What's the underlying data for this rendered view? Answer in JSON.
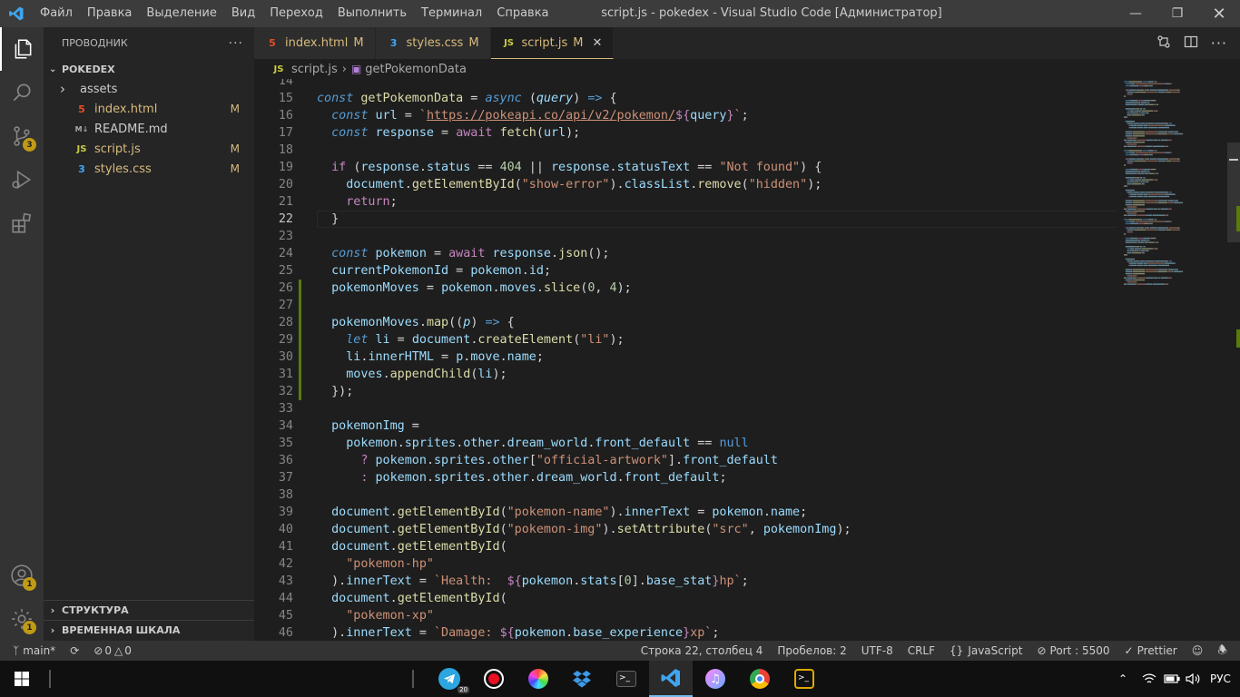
{
  "titlebar": {
    "menu": [
      "Файл",
      "Правка",
      "Выделение",
      "Вид",
      "Переход",
      "Выполнить",
      "Терминал",
      "Справка"
    ],
    "title": "script.js - pokedex - Visual Studio Code [Администратор]"
  },
  "activity": {
    "source_control_badge": "3",
    "accounts_badge": "1",
    "settings_badge": "1"
  },
  "explorer": {
    "header": "ПРОВОДНИК",
    "root": "POKEDEX",
    "items": [
      {
        "name": "assets",
        "icon": "folder-chevron",
        "mod": ""
      },
      {
        "name": "index.html",
        "icon": "html",
        "mod": "M"
      },
      {
        "name": "README.md",
        "icon": "md",
        "mod": ""
      },
      {
        "name": "script.js",
        "icon": "js",
        "mod": "M"
      },
      {
        "name": "styles.css",
        "icon": "css",
        "mod": "M"
      }
    ],
    "outline": "СТРУКТУРА",
    "timeline": "ВРЕМЕННАЯ ШКАЛА"
  },
  "tabs": [
    {
      "label": "index.html",
      "mod": "M",
      "icon": "html"
    },
    {
      "label": "styles.css",
      "mod": "M",
      "icon": "css"
    },
    {
      "label": "script.js",
      "mod": "M",
      "icon": "js",
      "active": true
    }
  ],
  "breadcrumb": {
    "file": "script.js",
    "symbol": "getPokemonData"
  },
  "editor": {
    "first_line": 14,
    "current_line": 22,
    "modified_lines": [
      26,
      27,
      28,
      29,
      30,
      31,
      32
    ]
  },
  "code_lines": [
    [],
    [
      [
        "kw",
        "const "
      ],
      [
        "fn",
        "getPokemonData"
      ],
      [
        "op",
        " = "
      ],
      [
        "kw",
        "async "
      ],
      [
        "op",
        "("
      ],
      [
        "prm",
        "query"
      ],
      [
        "op",
        ") "
      ],
      [
        "kw",
        "=>"
      ],
      [
        "op",
        " {"
      ]
    ],
    [
      [
        "op",
        "  "
      ],
      [
        "kw",
        "const "
      ],
      [
        "var",
        "url"
      ],
      [
        "op",
        " = "
      ],
      [
        "str",
        "`"
      ],
      [
        "url",
        "https://pokeapi.co/api/v2/pokemon/"
      ],
      [
        "kw2",
        "${"
      ],
      [
        "var",
        "query"
      ],
      [
        "kw2",
        "}"
      ],
      [
        "str",
        "`"
      ],
      [
        "op",
        ";"
      ]
    ],
    [
      [
        "op",
        "  "
      ],
      [
        "kw",
        "const "
      ],
      [
        "var",
        "response"
      ],
      [
        "op",
        " = "
      ],
      [
        "kw2",
        "await "
      ],
      [
        "fn",
        "fetch"
      ],
      [
        "op",
        "("
      ],
      [
        "var",
        "url"
      ],
      [
        "op",
        ");"
      ]
    ],
    [],
    [
      [
        "op",
        "  "
      ],
      [
        "kw2",
        "if "
      ],
      [
        "op",
        "("
      ],
      [
        "var",
        "response"
      ],
      [
        "op",
        "."
      ],
      [
        "var",
        "status"
      ],
      [
        "op",
        " == "
      ],
      [
        "num",
        "404"
      ],
      [
        "op",
        " || "
      ],
      [
        "var",
        "response"
      ],
      [
        "op",
        "."
      ],
      [
        "var",
        "statusText"
      ],
      [
        "op",
        " == "
      ],
      [
        "str",
        "\"Not found\""
      ],
      [
        "op",
        ") {"
      ]
    ],
    [
      [
        "op",
        "    "
      ],
      [
        "var",
        "document"
      ],
      [
        "op",
        "."
      ],
      [
        "fn",
        "getElementById"
      ],
      [
        "op",
        "("
      ],
      [
        "str",
        "\"show-error\""
      ],
      [
        "op",
        ")."
      ],
      [
        "var",
        "classList"
      ],
      [
        "op",
        "."
      ],
      [
        "fn",
        "remove"
      ],
      [
        "op",
        "("
      ],
      [
        "str",
        "\"hidden\""
      ],
      [
        "op",
        ");"
      ]
    ],
    [
      [
        "op",
        "    "
      ],
      [
        "kw2",
        "return"
      ],
      [
        "op",
        ";"
      ]
    ],
    [
      [
        "op",
        "  }"
      ]
    ],
    [],
    [
      [
        "op",
        "  "
      ],
      [
        "kw",
        "const "
      ],
      [
        "var",
        "pokemon"
      ],
      [
        "op",
        " = "
      ],
      [
        "kw2",
        "await "
      ],
      [
        "var",
        "response"
      ],
      [
        "op",
        "."
      ],
      [
        "fn",
        "json"
      ],
      [
        "op",
        "();"
      ]
    ],
    [
      [
        "op",
        "  "
      ],
      [
        "var",
        "currentPokemonId"
      ],
      [
        "op",
        " = "
      ],
      [
        "var",
        "pokemon"
      ],
      [
        "op",
        "."
      ],
      [
        "var",
        "id"
      ],
      [
        "op",
        ";"
      ]
    ],
    [
      [
        "op",
        "  "
      ],
      [
        "var",
        "pokemonMoves"
      ],
      [
        "op",
        " = "
      ],
      [
        "var",
        "pokemon"
      ],
      [
        "op",
        "."
      ],
      [
        "var",
        "moves"
      ],
      [
        "op",
        "."
      ],
      [
        "fn",
        "slice"
      ],
      [
        "op",
        "("
      ],
      [
        "num",
        "0"
      ],
      [
        "op",
        ", "
      ],
      [
        "num",
        "4"
      ],
      [
        "op",
        ");"
      ]
    ],
    [],
    [
      [
        "op",
        "  "
      ],
      [
        "var",
        "pokemonMoves"
      ],
      [
        "op",
        "."
      ],
      [
        "fn",
        "map"
      ],
      [
        "op",
        "(("
      ],
      [
        "prm",
        "p"
      ],
      [
        "op",
        ") "
      ],
      [
        "kw",
        "=>"
      ],
      [
        "op",
        " {"
      ]
    ],
    [
      [
        "op",
        "    "
      ],
      [
        "kw",
        "let "
      ],
      [
        "var",
        "li"
      ],
      [
        "op",
        " = "
      ],
      [
        "var",
        "document"
      ],
      [
        "op",
        "."
      ],
      [
        "fn",
        "createElement"
      ],
      [
        "op",
        "("
      ],
      [
        "str",
        "\"li\""
      ],
      [
        "op",
        ");"
      ]
    ],
    [
      [
        "op",
        "    "
      ],
      [
        "var",
        "li"
      ],
      [
        "op",
        "."
      ],
      [
        "var",
        "innerHTML"
      ],
      [
        "op",
        " = "
      ],
      [
        "var",
        "p"
      ],
      [
        "op",
        "."
      ],
      [
        "var",
        "move"
      ],
      [
        "op",
        "."
      ],
      [
        "var",
        "name"
      ],
      [
        "op",
        ";"
      ]
    ],
    [
      [
        "op",
        "    "
      ],
      [
        "var",
        "moves"
      ],
      [
        "op",
        "."
      ],
      [
        "fn",
        "appendChild"
      ],
      [
        "op",
        "("
      ],
      [
        "var",
        "li"
      ],
      [
        "op",
        ");"
      ]
    ],
    [
      [
        "op",
        "  });"
      ]
    ],
    [],
    [
      [
        "op",
        "  "
      ],
      [
        "var",
        "pokemonImg"
      ],
      [
        "op",
        " ="
      ]
    ],
    [
      [
        "op",
        "    "
      ],
      [
        "var",
        "pokemon"
      ],
      [
        "op",
        "."
      ],
      [
        "var",
        "sprites"
      ],
      [
        "op",
        "."
      ],
      [
        "var",
        "other"
      ],
      [
        "op",
        "."
      ],
      [
        "var",
        "dream_world"
      ],
      [
        "op",
        "."
      ],
      [
        "var",
        "front_default"
      ],
      [
        "op",
        " == "
      ],
      [
        "kwn",
        "null"
      ]
    ],
    [
      [
        "op",
        "      "
      ],
      [
        "kw2",
        "? "
      ],
      [
        "var",
        "pokemon"
      ],
      [
        "op",
        "."
      ],
      [
        "var",
        "sprites"
      ],
      [
        "op",
        "."
      ],
      [
        "var",
        "other"
      ],
      [
        "op",
        "["
      ],
      [
        "str",
        "\"official-artwork\""
      ],
      [
        "op",
        "]."
      ],
      [
        "var",
        "front_default"
      ]
    ],
    [
      [
        "op",
        "      "
      ],
      [
        "kw2",
        ": "
      ],
      [
        "var",
        "pokemon"
      ],
      [
        "op",
        "."
      ],
      [
        "var",
        "sprites"
      ],
      [
        "op",
        "."
      ],
      [
        "var",
        "other"
      ],
      [
        "op",
        "."
      ],
      [
        "var",
        "dream_world"
      ],
      [
        "op",
        "."
      ],
      [
        "var",
        "front_default"
      ],
      [
        "op",
        ";"
      ]
    ],
    [],
    [
      [
        "op",
        "  "
      ],
      [
        "var",
        "document"
      ],
      [
        "op",
        "."
      ],
      [
        "fn",
        "getElementById"
      ],
      [
        "op",
        "("
      ],
      [
        "str",
        "\"pokemon-name\""
      ],
      [
        "op",
        ")."
      ],
      [
        "var",
        "innerText"
      ],
      [
        "op",
        " = "
      ],
      [
        "var",
        "pokemon"
      ],
      [
        "op",
        "."
      ],
      [
        "var",
        "name"
      ],
      [
        "op",
        ";"
      ]
    ],
    [
      [
        "op",
        "  "
      ],
      [
        "var",
        "document"
      ],
      [
        "op",
        "."
      ],
      [
        "fn",
        "getElementById"
      ],
      [
        "op",
        "("
      ],
      [
        "str",
        "\"pokemon-img\""
      ],
      [
        "op",
        ")."
      ],
      [
        "fn",
        "setAttribute"
      ],
      [
        "op",
        "("
      ],
      [
        "str",
        "\"src\""
      ],
      [
        "op",
        ", "
      ],
      [
        "var",
        "pokemonImg"
      ],
      [
        "op",
        ");"
      ]
    ],
    [
      [
        "op",
        "  "
      ],
      [
        "var",
        "document"
      ],
      [
        "op",
        "."
      ],
      [
        "fn",
        "getElementById"
      ],
      [
        "op",
        "("
      ]
    ],
    [
      [
        "op",
        "    "
      ],
      [
        "str",
        "\"pokemon-hp\""
      ]
    ],
    [
      [
        "op",
        "  )."
      ],
      [
        "var",
        "innerText"
      ],
      [
        "op",
        " = "
      ],
      [
        "str",
        "`Health:  "
      ],
      [
        "kw2",
        "${"
      ],
      [
        "var",
        "pokemon"
      ],
      [
        "op",
        "."
      ],
      [
        "var",
        "stats"
      ],
      [
        "op",
        "["
      ],
      [
        "num",
        "0"
      ],
      [
        "op",
        "]."
      ],
      [
        "var",
        "base_stat"
      ],
      [
        "kw2",
        "}"
      ],
      [
        "str",
        "hp`"
      ],
      [
        "op",
        ";"
      ]
    ],
    [
      [
        "op",
        "  "
      ],
      [
        "var",
        "document"
      ],
      [
        "op",
        "."
      ],
      [
        "fn",
        "getElementById"
      ],
      [
        "op",
        "("
      ]
    ],
    [
      [
        "op",
        "    "
      ],
      [
        "str",
        "\"pokemon-xp\""
      ]
    ],
    [
      [
        "op",
        "  )."
      ],
      [
        "var",
        "innerText"
      ],
      [
        "op",
        " = "
      ],
      [
        "str",
        "`Damage: "
      ],
      [
        "kw2",
        "${"
      ],
      [
        "var",
        "pokemon"
      ],
      [
        "op",
        "."
      ],
      [
        "var",
        "base_experience"
      ],
      [
        "kw2",
        "}"
      ],
      [
        "str",
        "xp`"
      ],
      [
        "op",
        ";"
      ]
    ]
  ],
  "status": {
    "branch": "main*",
    "errors": "0",
    "warnings": "0",
    "position": "Строка 22, столбец 4",
    "spaces": "Пробелов: 2",
    "encoding": "UTF-8",
    "eol": "CRLF",
    "language": "JavaScript",
    "port": "Port : 5500",
    "prettier": "Prettier"
  },
  "taskbar": {
    "telegram_badge": "20",
    "lang": "РУС",
    "apps": [
      "start-icon",
      "telegram-icon",
      "record-icon",
      "color-picker-icon",
      "dropbox-icon",
      "terminal-icon",
      "vscode-icon",
      "itunes-icon",
      "chrome-icon",
      "terminal-2-icon"
    ]
  }
}
